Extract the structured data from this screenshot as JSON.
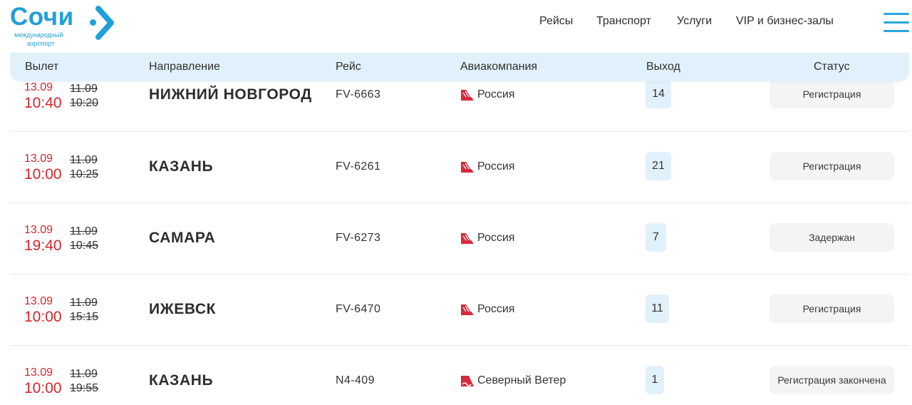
{
  "header": {
    "logo_title": "Сочи",
    "logo_subtitle_1": "международный",
    "logo_subtitle_2": "аэропорт",
    "nav": [
      "Рейсы",
      "Транспорт",
      "Услуги",
      "VIP и бизнес-залы"
    ],
    "menu_icon": "hamburger-menu-icon",
    "accent_color": "#1fa0d8"
  },
  "table": {
    "columns": [
      "Вылет",
      "Направление",
      "Рейс",
      "Авиакомпания",
      "Выход",
      "Статус"
    ],
    "date_color": "#d6252b",
    "rows": [
      {
        "new_date": "13.09",
        "new_time": "10:40",
        "old_date": "11.09",
        "old_time": "10:20",
        "destination": "НИЖНИЙ НОВГОРОД",
        "flight": "FV-6663",
        "airline": "Россия",
        "airline_icon": "rossiya-logo-icon",
        "gate": "14",
        "status": "Регистрация"
      },
      {
        "new_date": "13.09",
        "new_time": "10:00",
        "old_date": "11.09",
        "old_time": "10:25",
        "destination": "КАЗАНЬ",
        "flight": "FV-6261",
        "airline": "Россия",
        "airline_icon": "rossiya-logo-icon",
        "gate": "21",
        "status": "Регистрация"
      },
      {
        "new_date": "13.09",
        "new_time": "19:40",
        "old_date": "11.09",
        "old_time": "10:45",
        "destination": "САМАРА",
        "flight": "FV-6273",
        "airline": "Россия",
        "airline_icon": "rossiya-logo-icon",
        "gate": "7",
        "status": "Задержан"
      },
      {
        "new_date": "13.09",
        "new_time": "10:00",
        "old_date": "11.09",
        "old_time": "15:15",
        "destination": "ИЖЕВСК",
        "flight": "FV-6470",
        "airline": "Россия",
        "airline_icon": "rossiya-logo-icon",
        "gate": "11",
        "status": "Регистрация"
      },
      {
        "new_date": "13.09",
        "new_time": "10:00",
        "old_date": "11.09",
        "old_time": "19:55",
        "destination": "КАЗАНЬ",
        "flight": "N4-409",
        "airline": "Северный Ветер",
        "airline_icon": "nordwind-logo-icon",
        "gate": "1",
        "status": "Регистрация закончена"
      }
    ]
  }
}
